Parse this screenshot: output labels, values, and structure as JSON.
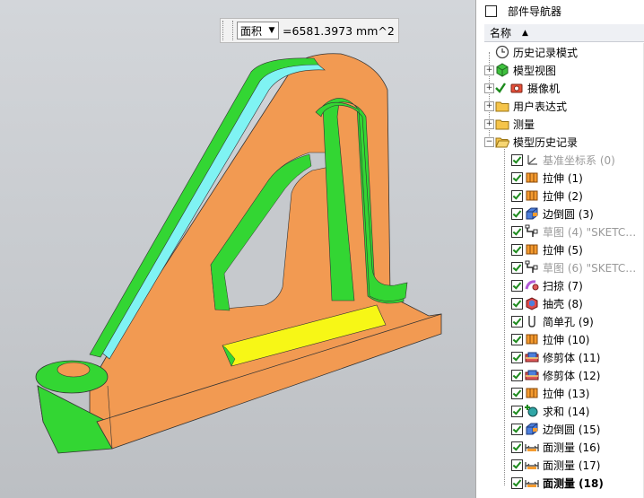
{
  "measure": {
    "select_label": "面积",
    "dropdown_arrow": "▼",
    "value": "=6581.3973 mm^2"
  },
  "navigator": {
    "title": "部件导航器",
    "column_name": "名称",
    "sort_arrow": "▲",
    "groups": [
      {
        "label": "历史记录模式",
        "icon": "clock-icon"
      },
      {
        "label": "模型视图",
        "icon": "model-views-icon"
      },
      {
        "label": "摄像机",
        "icon": "camera-check-icon"
      },
      {
        "label": "用户表达式",
        "icon": "folder-icon"
      },
      {
        "label": "测量",
        "icon": "folder-icon"
      },
      {
        "label": "模型历史记录",
        "icon": "folder-open-icon"
      }
    ],
    "features": [
      {
        "label": "基准坐标系 (0)",
        "icon": "datum-csys-icon",
        "dim": true
      },
      {
        "label": "拉伸 (1)",
        "icon": "extrude-icon"
      },
      {
        "label": "拉伸 (2)",
        "icon": "extrude-icon"
      },
      {
        "label": "边倒圆 (3)",
        "icon": "edge-blend-icon"
      },
      {
        "label": "草图 (4) \"SKETC…",
        "icon": "sketch-icon",
        "dim": true
      },
      {
        "label": "拉伸 (5)",
        "icon": "extrude-icon"
      },
      {
        "label": "草图 (6) \"SKETC…",
        "icon": "sketch-icon",
        "dim": true
      },
      {
        "label": "扫掠 (7)",
        "icon": "swept-icon"
      },
      {
        "label": "抽壳 (8)",
        "icon": "shell-icon"
      },
      {
        "label": "简单孔 (9)",
        "icon": "hole-icon"
      },
      {
        "label": "拉伸 (10)",
        "icon": "extrude-icon"
      },
      {
        "label": "修剪体 (11)",
        "icon": "trim-body-icon"
      },
      {
        "label": "修剪体 (12)",
        "icon": "trim-body-icon"
      },
      {
        "label": "拉伸 (13)",
        "icon": "extrude-icon"
      },
      {
        "label": "求和 (14)",
        "icon": "unite-icon"
      },
      {
        "label": "边倒圆 (15)",
        "icon": "edge-blend-icon"
      },
      {
        "label": "面测量 (16)",
        "icon": "face-measure-icon"
      },
      {
        "label": "面测量 (17)",
        "icon": "face-measure-icon"
      },
      {
        "label": "面测量 (18)",
        "icon": "face-measure-icon",
        "bold": true
      }
    ]
  },
  "colors": {
    "orange_face": "#f29a52",
    "green_face": "#33d633",
    "cyan_face": "#7ff3f3",
    "yellow_face": "#f7f716",
    "check_green": "#1c8a1c"
  }
}
